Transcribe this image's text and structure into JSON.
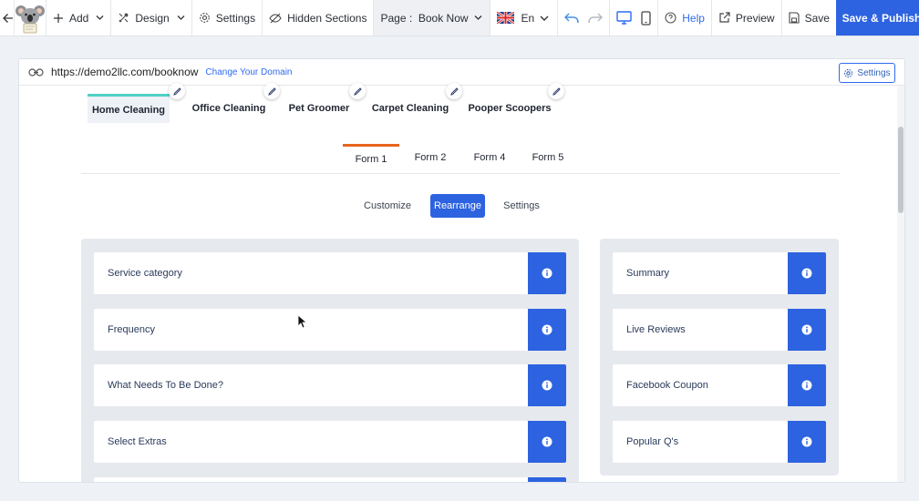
{
  "toolbar": {
    "add": "Add",
    "design": "Design",
    "settings": "Settings",
    "hidden_sections": "Hidden Sections",
    "page_label": "Page :",
    "page_value": "Book Now",
    "language": "En",
    "help": "Help",
    "preview": "Preview",
    "save": "Save",
    "publish": "Save & Publish"
  },
  "urlbar": {
    "url": "https://demo2llc.com/booknow",
    "change_domain": "Change Your Domain",
    "settings": "Settings"
  },
  "categories": [
    "Home Cleaning",
    "Office Cleaning",
    "Pet Groomer",
    "Carpet Cleaning",
    "Pooper Scoopers"
  ],
  "active_category": "Home Cleaning",
  "forms": [
    "Form 1",
    "Form 2",
    "Form 4",
    "Form 5"
  ],
  "active_form": "Form 1",
  "subtabs": [
    "Customize",
    "Rearrange",
    "Settings"
  ],
  "active_subtab": "Rearrange",
  "left_sections": [
    "Service category",
    "Frequency",
    "What Needs To Be Done?",
    "Select Extras"
  ],
  "right_sections": [
    "Summary",
    "Live Reviews",
    "Facebook Coupon",
    "Popular Q's"
  ],
  "colors": {
    "primary": "#2d63e0",
    "category_accent": "#4fd1c5",
    "form_accent": "#e8651e"
  }
}
